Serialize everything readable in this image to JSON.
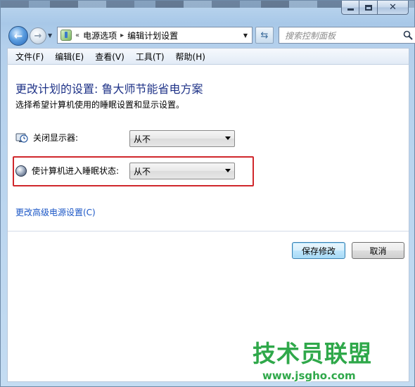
{
  "window": {
    "caption_buttons": {
      "minimize": "minimize-icon",
      "maximize": "maximize-icon",
      "close": "close-icon"
    }
  },
  "nav": {
    "breadcrumb": [
      {
        "label": "电源选项"
      },
      {
        "label": "编辑计划设置"
      }
    ],
    "breadcrumb_lead": "«",
    "breadcrumb_sep": "▸",
    "search_placeholder": "搜索控制面板"
  },
  "menu": {
    "items": [
      "文件(F)",
      "编辑(E)",
      "查看(V)",
      "工具(T)",
      "帮助(H)"
    ]
  },
  "content": {
    "title": "更改计划的设置: 鲁大师节能省电方案",
    "subtitle": "选择希望计算机使用的睡眠设置和显示设置。",
    "rows": [
      {
        "label": "关闭显示器:",
        "value": "从不"
      },
      {
        "label": "使计算机进入睡眠状态:",
        "value": "从不"
      }
    ],
    "advanced_link": "更改高级电源设置(C)",
    "save_button": "保存修改",
    "cancel_button": "取消"
  },
  "watermark": {
    "brand": "技术员联盟",
    "url": "www.jsgho.com"
  },
  "colors": {
    "title": "#1e3287",
    "link": "#1a56c6",
    "highlight": "#d0272c",
    "watermark": "#2fa84a"
  }
}
